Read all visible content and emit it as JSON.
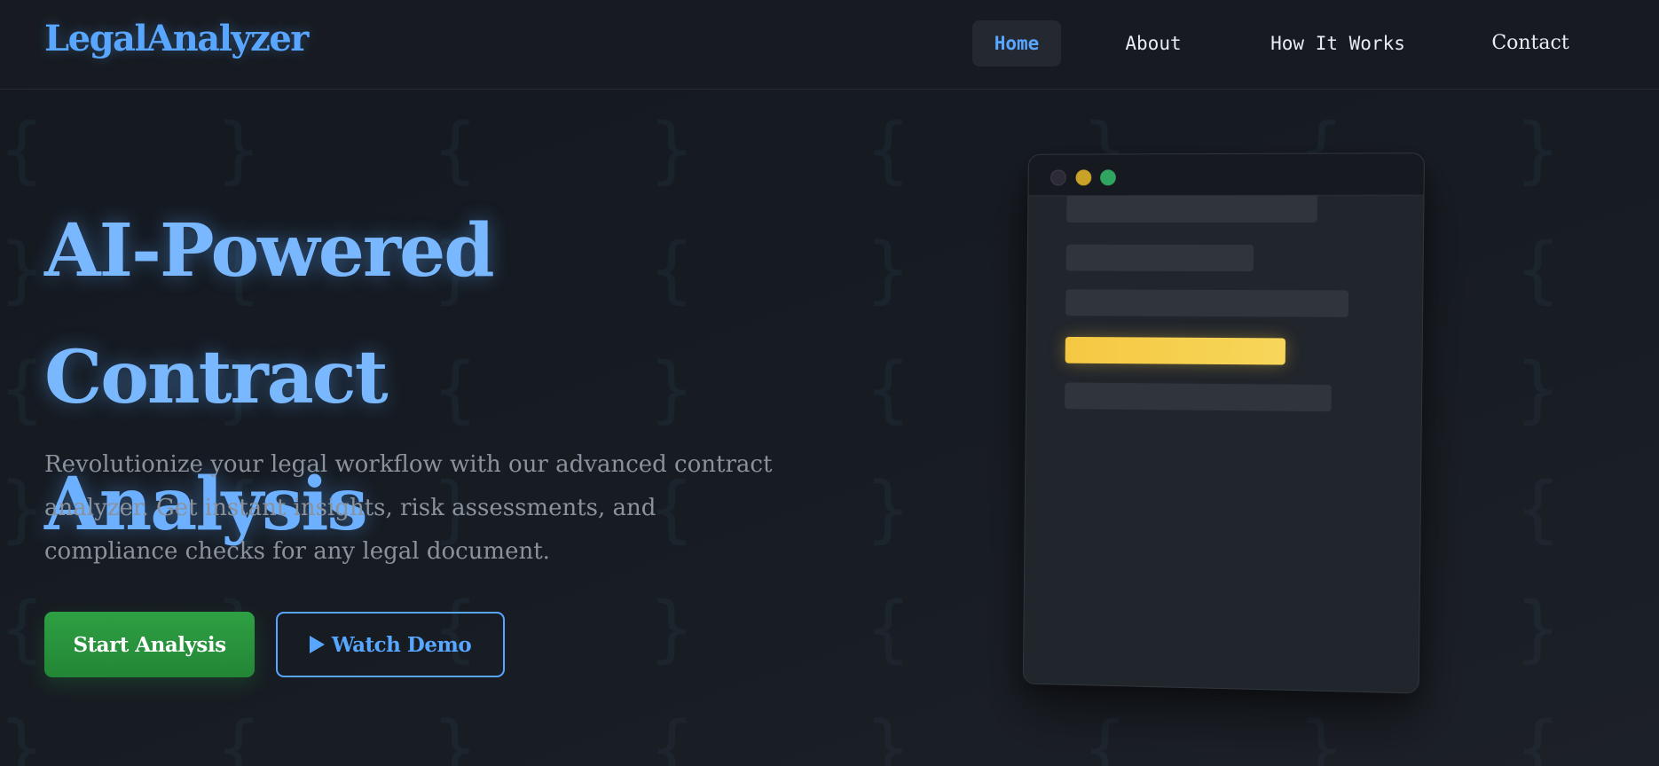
{
  "header": {
    "logo": "LegalAnalyzer",
    "nav": [
      {
        "label": "Home",
        "active": true
      },
      {
        "label": "About"
      },
      {
        "label": "How It Works"
      },
      {
        "label": "Contact"
      }
    ]
  },
  "hero": {
    "title_line1": "AI-Powered Contract",
    "title_line2": "Analysis",
    "description": "Revolutionize your legal workflow with our advanced contract analyzer. Get instant insights, risk assessments, and compliance checks for any legal document.",
    "primary_button": "Start Analysis",
    "secondary_button": "Watch Demo",
    "secondary_button_icon": "play-icon"
  },
  "mockup": {
    "window_dots": [
      "close-dot",
      "minimize-dot",
      "maximize-dot"
    ],
    "highlighted_line": "yellow-highlight"
  },
  "colors": {
    "background": "#15191f",
    "accent": "#58a6ff",
    "title": "#79b8ff",
    "primary_button": "#2ea043",
    "highlight": "#f5c842",
    "muted_text": "#8b929b"
  }
}
